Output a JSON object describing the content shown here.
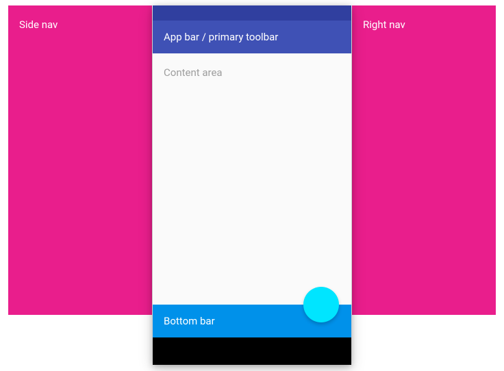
{
  "side_nav": {
    "label": "Side nav"
  },
  "right_nav": {
    "label": "Right nav"
  },
  "app_bar": {
    "label": "App bar / primary toolbar"
  },
  "content_area": {
    "label": "Content area"
  },
  "bottom_bar": {
    "label": "Bottom bar"
  },
  "colors": {
    "nav_panel": "#e91e8c",
    "status_bar": "#303f9f",
    "app_bar": "#3f51b5",
    "content_bg": "#fafafa",
    "bottom_bar": "#0091ea",
    "bottom_nav": "#000000",
    "fab": "#00e5ff"
  }
}
